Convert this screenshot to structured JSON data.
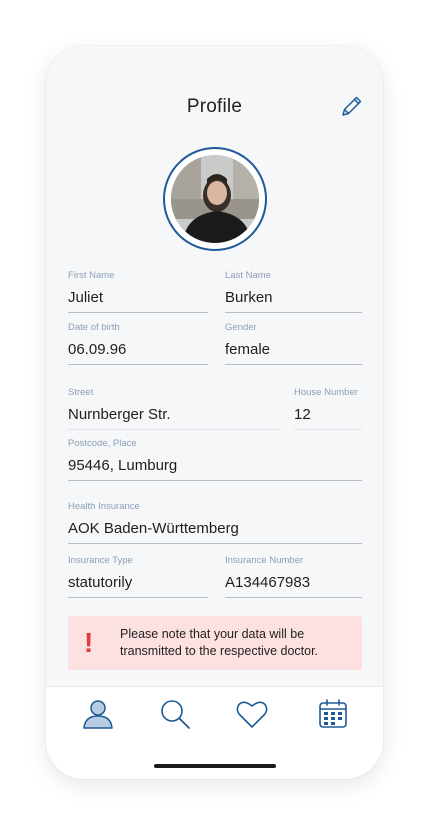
{
  "header": {
    "title": "Profile",
    "edit_icon": "pencil-icon"
  },
  "profile": {
    "photo": "profile-photo"
  },
  "form": {
    "first_name": {
      "label": "First Name",
      "value": "Juliet"
    },
    "last_name": {
      "label": "Last Name",
      "value": "Burken"
    },
    "dob": {
      "label": "Date of birth",
      "value": "06.09.96"
    },
    "gender": {
      "label": "Gender",
      "value": "female"
    },
    "street": {
      "label": "Street",
      "value": "Nurnberger Str."
    },
    "house_number": {
      "label": "House Number",
      "value": "12"
    },
    "postcode": {
      "label": "Postcode, Place",
      "value": "95446, Lumburg"
    },
    "health_insurance": {
      "label": "Health Insurance",
      "value": "AOK Baden-Württemberg"
    },
    "insurance_type": {
      "label": "Insurance Type",
      "value": "statutorily"
    },
    "insurance_number": {
      "label": "Insurance Number",
      "value": "A134467983"
    }
  },
  "notice": {
    "icon": "!",
    "text": "Please note that your data will be transmitted to the respective doctor."
  },
  "nav": {
    "items": [
      {
        "icon": "user-icon"
      },
      {
        "icon": "search-icon"
      },
      {
        "icon": "heart-icon"
      },
      {
        "icon": "calendar-icon"
      }
    ]
  },
  "colors": {
    "accent": "#1d5a96",
    "label": "#8a9fb6",
    "notice_bg": "#fde0e0",
    "notice_icon": "#e23b3b"
  }
}
